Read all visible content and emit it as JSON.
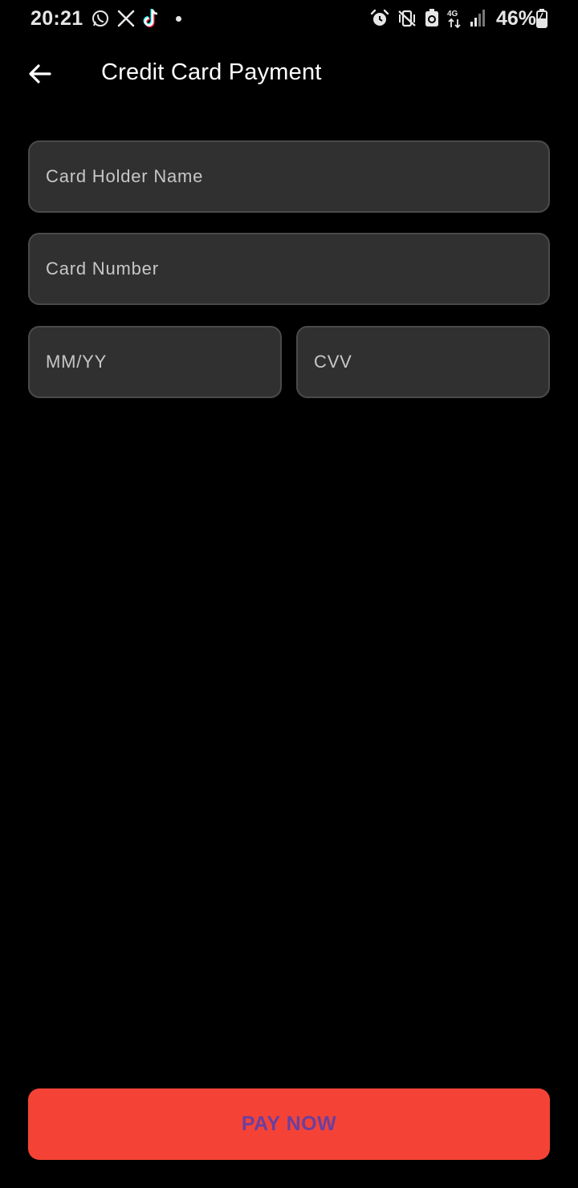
{
  "status_bar": {
    "time": "20:21",
    "battery": "46%",
    "network": "4G",
    "notification_icons": [
      "whatsapp-icon",
      "x-icon",
      "tiktok-icon"
    ],
    "system_icons": [
      "alarm-icon",
      "vibrate-icon",
      "battery-saver-icon",
      "4g-icon",
      "signal-icon",
      "battery-icon"
    ]
  },
  "app_bar": {
    "title": "Credit Card Payment",
    "back_icon": "arrow-left-icon"
  },
  "form": {
    "card_holder_name": {
      "placeholder": "Card Holder Name",
      "value": ""
    },
    "card_number": {
      "placeholder": "Card Number",
      "value": ""
    },
    "expiry": {
      "placeholder": "MM/YY",
      "value": ""
    },
    "cvv": {
      "placeholder": "CVV",
      "value": ""
    }
  },
  "pay_button": {
    "label": "PAY NOW"
  },
  "colors": {
    "background": "#000000",
    "field_bg": "#303030",
    "field_border": "#4a4a4a",
    "button_bg": "#f44336",
    "button_text": "#6b3fa0"
  }
}
